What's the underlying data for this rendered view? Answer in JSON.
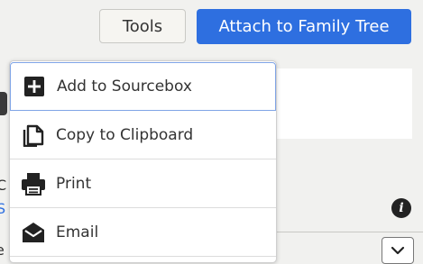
{
  "toolbar": {
    "tools_label": "Tools",
    "attach_label": "Attach to Family Tree"
  },
  "background": {
    "edge_letter_1": "C",
    "edge_letter_2": "S",
    "edge_letter_3": "e"
  },
  "menu": {
    "items": [
      {
        "label": "Add to Sourcebox",
        "icon": "plus-box-icon"
      },
      {
        "label": "Copy to Clipboard",
        "icon": "copy-icon"
      },
      {
        "label": "Print",
        "icon": "printer-icon"
      },
      {
        "label": "Email",
        "icon": "envelope-icon"
      }
    ]
  },
  "colors": {
    "accent": "#2e6fe0",
    "focus_border": "#7fa4e6",
    "icon_dark": "#222222"
  }
}
